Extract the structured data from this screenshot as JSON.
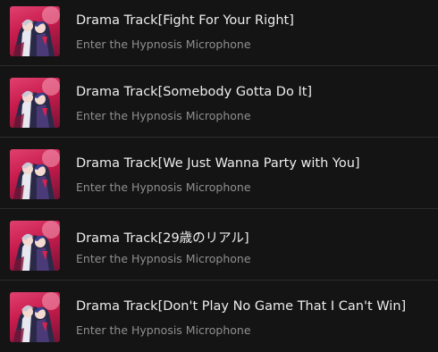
{
  "tracks": [
    {
      "title": "Drama Track[Fight For Your Right]",
      "artist": "Enter the Hypnosis Microphone",
      "cover_icon": "album-cover"
    },
    {
      "title": "Drama Track[Somebody Gotta Do It]",
      "artist": "Enter the Hypnosis Microphone",
      "cover_icon": "album-cover"
    },
    {
      "title": "Drama Track[We Just Wanna Party with You]",
      "artist": "Enter the Hypnosis Microphone",
      "cover_icon": "album-cover"
    },
    {
      "title": "Drama Track[29歳のリアル]",
      "artist": "Enter the Hypnosis Microphone",
      "cover_icon": "album-cover"
    },
    {
      "title": "Drama Track[Don't Play No Game That I Can't Win]",
      "artist": "Enter the Hypnosis Microphone",
      "cover_icon": "album-cover"
    }
  ],
  "colors": {
    "background": "#141414",
    "title_text": "#ededed",
    "subtitle_text": "#8f8f8f",
    "divider": "#2c2c2c",
    "cover_accent": "#c71b4c"
  }
}
